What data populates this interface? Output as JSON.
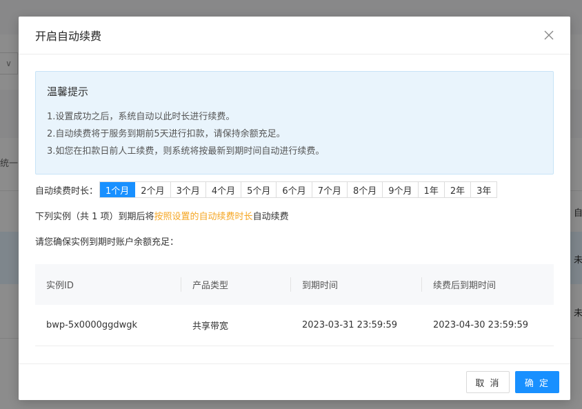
{
  "background": {
    "select_arrow": "∨",
    "left_text": "统一",
    "right_texts": [
      "自",
      "未",
      "未"
    ]
  },
  "modal": {
    "title": "开启自动续费",
    "close_icon": "close-icon"
  },
  "notice": {
    "title": "温馨提示",
    "lines": [
      "1.设置成功之后，系统自动以此时长进行续费。",
      "2.自动续费将于服务到期前5天进行扣款，请保持余额充足。",
      "3.如您在扣款日前人工续费，则系统将按最新到期时间自动进行续费。"
    ]
  },
  "duration": {
    "label": "自动续费时长：",
    "options": [
      "1个月",
      "2个月",
      "3个月",
      "4个月",
      "5个月",
      "6个月",
      "7个月",
      "8个月",
      "9个月",
      "1年",
      "2年",
      "3年"
    ],
    "selected": "1个月"
  },
  "description": {
    "prefix": "下列实例（共 1 项）到期后将",
    "highlight": "按照设置的自动续费时长",
    "suffix": "自动续费",
    "balance_note": "请您确保实例到期时账户余额充足："
  },
  "table": {
    "headers": [
      "实例ID",
      "产品类型",
      "到期时间",
      "续费后到期时间"
    ],
    "rows": [
      [
        "bwp-5x0000ggdwgk",
        "共享带宽",
        "2023-03-31 23:59:59",
        "2023-04-30 23:59:59"
      ]
    ]
  },
  "footer": {
    "cancel_label": "取 消",
    "ok_label": "确 定"
  },
  "colors": {
    "primary": "#1890ff",
    "highlight": "#f5a623",
    "notice_bg": "#e9f4fc"
  }
}
